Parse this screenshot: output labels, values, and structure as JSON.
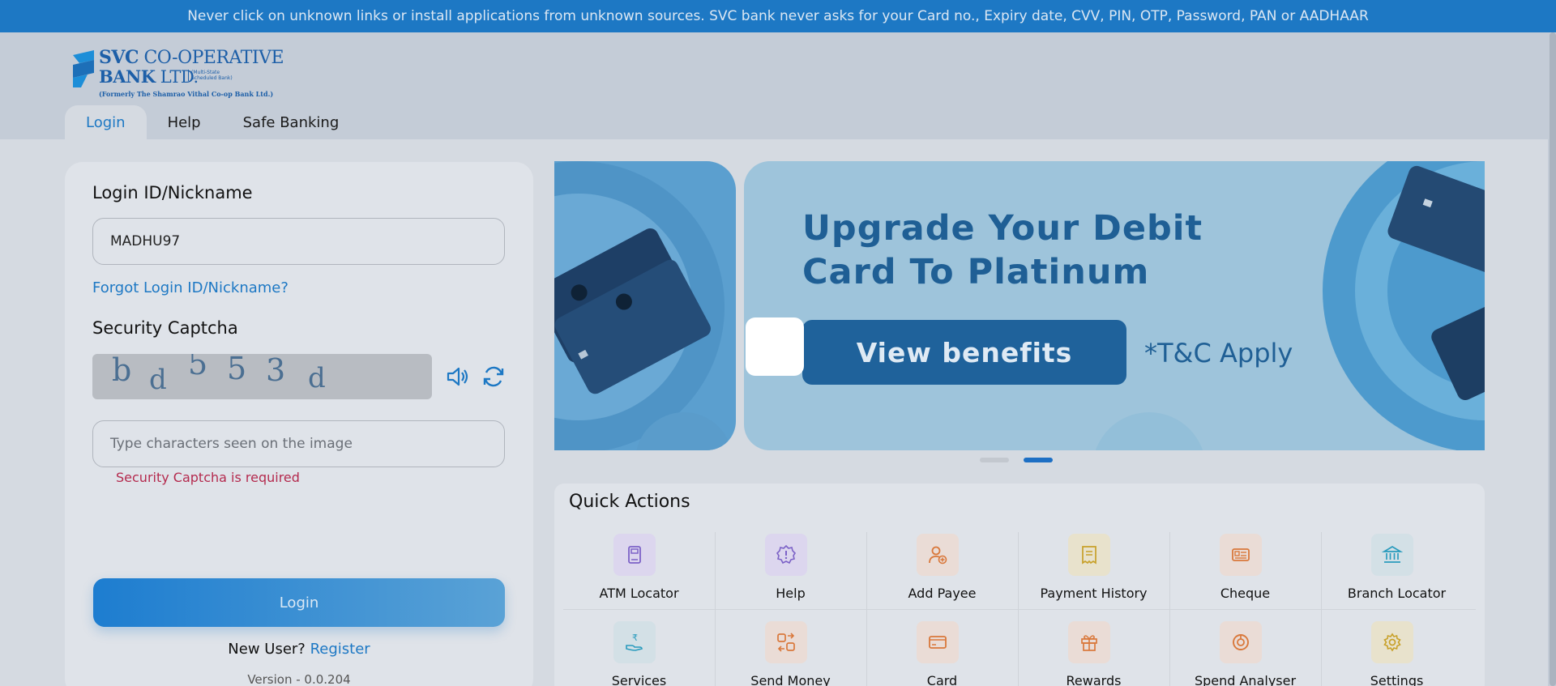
{
  "notice": "Never click on unknown links or install applications from unknown sources. SVC bank never asks for your Card no., Expiry date, CVV, PIN, OTP, Password, PAN or AADHAAR",
  "logo": {
    "line1_bold": "SVC",
    "line1_rest": "CO-OPERATIVE",
    "line2_bold": "BANK",
    "line2_rest": "LTD.",
    "sub": "(Multi-State Scheduled Bank)",
    "formerly": "(Formerly The Shamrao Vithal Co-op Bank Ltd.)"
  },
  "tabs": [
    {
      "label": "Login",
      "active": true
    },
    {
      "label": "Help",
      "active": false
    },
    {
      "label": "Safe Banking",
      "active": false
    }
  ],
  "login": {
    "id_label": "Login ID/Nickname",
    "id_value": "MADHU97",
    "forgot_link": "Forgot Login ID/Nickname?",
    "captcha_label": "Security Captcha",
    "captcha_chars": [
      "b",
      "d",
      "5",
      "5",
      "3",
      "d"
    ],
    "captcha_placeholder": "Type characters seen on the image",
    "captcha_error": "Security Captcha is required",
    "login_button": "Login",
    "new_user_text": "New User?",
    "register_link": "Register",
    "version": "Version - 0.0.204"
  },
  "banner": {
    "title_line1": "Upgrade Your Debit",
    "title_line2": "Card To Platinum",
    "cta": "View benefits",
    "tc": "*T&C Apply",
    "slide_index": 2,
    "slide_count": 2
  },
  "quick_actions": {
    "title": "Quick Actions",
    "items": [
      {
        "label": "ATM Locator",
        "icon": "atm-icon",
        "bg": "#dcd6ee",
        "color": "#7c62c7"
      },
      {
        "label": "Help",
        "icon": "help-icon",
        "bg": "#dcd6ee",
        "color": "#7c62c7"
      },
      {
        "label": "Add Payee",
        "icon": "add-payee-icon",
        "bg": "#eadcd6",
        "color": "#d9783b"
      },
      {
        "label": "Payment History",
        "icon": "payment-history-icon",
        "bg": "#e8e2cc",
        "color": "#c8a12a"
      },
      {
        "label": "Cheque",
        "icon": "cheque-icon",
        "bg": "#eadcd6",
        "color": "#d9783b"
      },
      {
        "label": "Branch Locator",
        "icon": "bank-building-icon",
        "bg": "#d3e0e6",
        "color": "#2a9bbd"
      },
      {
        "label": "Services",
        "icon": "services-icon",
        "bg": "#d3e0e6",
        "color": "#2a9bbd"
      },
      {
        "label": "Send Money",
        "icon": "send-money-icon",
        "bg": "#eadcd6",
        "color": "#d9783b"
      },
      {
        "label": "Card",
        "icon": "card-icon",
        "bg": "#eadcd6",
        "color": "#d9783b"
      },
      {
        "label": "Rewards",
        "icon": "rewards-icon",
        "bg": "#eadcd6",
        "color": "#d9783b"
      },
      {
        "label": "Spend Analyser",
        "icon": "spend-analyser-icon",
        "bg": "#eadcd6",
        "color": "#d9783b"
      },
      {
        "label": "Settings",
        "icon": "settings-icon",
        "bg": "#e8e2cc",
        "color": "#c8a12a"
      }
    ]
  },
  "colors": {
    "brand_blue": "#1d78c4",
    "error": "#b42a4e"
  }
}
